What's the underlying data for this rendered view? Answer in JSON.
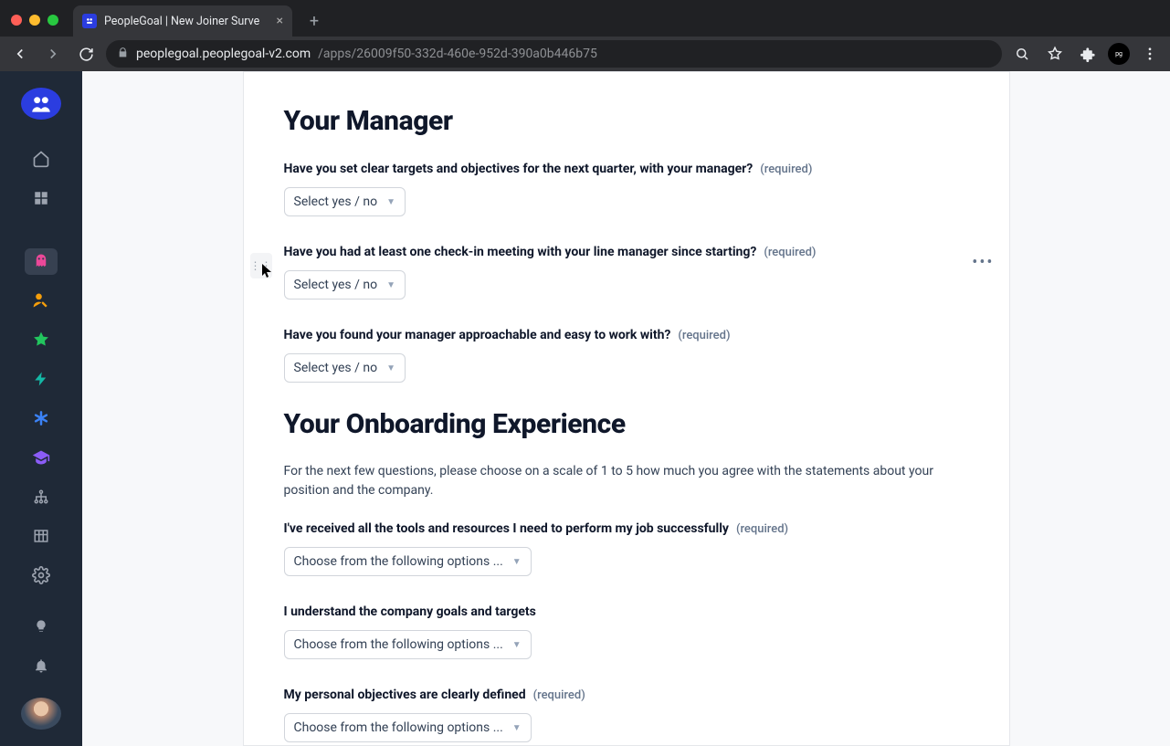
{
  "browser": {
    "tab_title": "PeopleGoal | New Joiner Surve",
    "url_host": "peoplegoal.peoplegoal-v2.com",
    "url_path": "/apps/26009f50-332d-460e-952d-390a0b446b75"
  },
  "sections": [
    {
      "title": "Your Manager",
      "intro": null,
      "questions": [
        {
          "label": "Have you set clear targets and objectives for the next quarter, with your manager?",
          "required": true,
          "placeholder": "Select yes / no",
          "has_handle": true
        },
        {
          "label": "Have you had at least one check-in meeting with your line manager since starting?",
          "required": true,
          "placeholder": "Select yes / no"
        },
        {
          "label": "Have you found your manager approachable and easy to work with?",
          "required": true,
          "placeholder": "Select yes / no"
        }
      ]
    },
    {
      "title": "Your Onboarding Experience",
      "intro": "For the next few questions, please choose on a scale of 1 to 5 how much you agree with the statements about your position and the company.",
      "questions": [
        {
          "label": "I've received all the tools and resources I need to perform my job successfully",
          "required": true,
          "placeholder": "Choose from the following options ..."
        },
        {
          "label": "I understand the company goals and targets",
          "required": false,
          "placeholder": "Choose from the following options ..."
        },
        {
          "label": "My personal objectives are clearly defined",
          "required": true,
          "placeholder": "Choose from the following options ..."
        }
      ]
    }
  ],
  "required_label": "(required)"
}
